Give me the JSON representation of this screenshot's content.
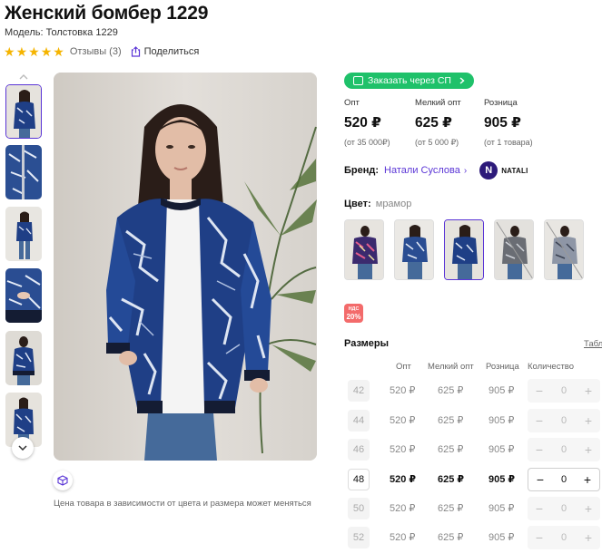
{
  "product": {
    "title": "Женский бомбер 1229",
    "model": "Модель: Толстовка 1229",
    "rating_stars": 5,
    "reviews": "Отзывы (3)",
    "share": "Поделиться"
  },
  "gallery": {
    "price_note": "Цена товара в зависимости от цвета и размера может меняться"
  },
  "purchase": {
    "sp_button": "Заказать через СП",
    "prices": [
      {
        "label": "Опт",
        "value": "520 ₽",
        "sub": "(от 35 000₽)"
      },
      {
        "label": "Мелкий опт",
        "value": "625 ₽",
        "sub": "(от 5 000 ₽)"
      },
      {
        "label": "Розница",
        "value": "905 ₽",
        "sub": "(от 1 товара)"
      }
    ],
    "brand_label": "Бренд:",
    "brand_name": "Натали Суслова",
    "brand_logo_letter": "N",
    "brand_logo_text": "NATALI",
    "color_label": "Цвет:",
    "color_value": "мрамор",
    "vat_top": "НДС",
    "vat_value": "20%"
  },
  "sizes": {
    "title": "Размеры",
    "table_link": "Табл",
    "headers": {
      "opt": "Опт",
      "small": "Мелкий опт",
      "retail": "Розница",
      "qty": "Количество"
    },
    "rows": [
      {
        "size": "42",
        "opt": "520 ₽",
        "small": "625 ₽",
        "retail": "905 ₽",
        "qty": "0",
        "available": false
      },
      {
        "size": "44",
        "opt": "520 ₽",
        "small": "625 ₽",
        "retail": "905 ₽",
        "qty": "0",
        "available": false
      },
      {
        "size": "46",
        "opt": "520 ₽",
        "small": "625 ₽",
        "retail": "905 ₽",
        "qty": "0",
        "available": false
      },
      {
        "size": "48",
        "opt": "520 ₽",
        "small": "625 ₽",
        "retail": "905 ₽",
        "qty": "0",
        "available": true
      },
      {
        "size": "50",
        "opt": "520 ₽",
        "small": "625 ₽",
        "retail": "905 ₽",
        "qty": "0",
        "available": false
      },
      {
        "size": "52",
        "opt": "520 ₽",
        "small": "625 ₽",
        "retail": "905 ₽",
        "qty": "0",
        "available": false
      }
    ]
  },
  "colors": {
    "accent": "#5a35d6",
    "green": "#1fc16a",
    "jacket": "#1f3f86",
    "star": "#f5b400"
  },
  "icons": [
    "star-icon",
    "share-icon",
    "chevron-up-icon",
    "chevron-down-icon",
    "cube-3d-icon",
    "cart-icon",
    "chevron-right-icon",
    "minus-icon",
    "plus-icon"
  ]
}
